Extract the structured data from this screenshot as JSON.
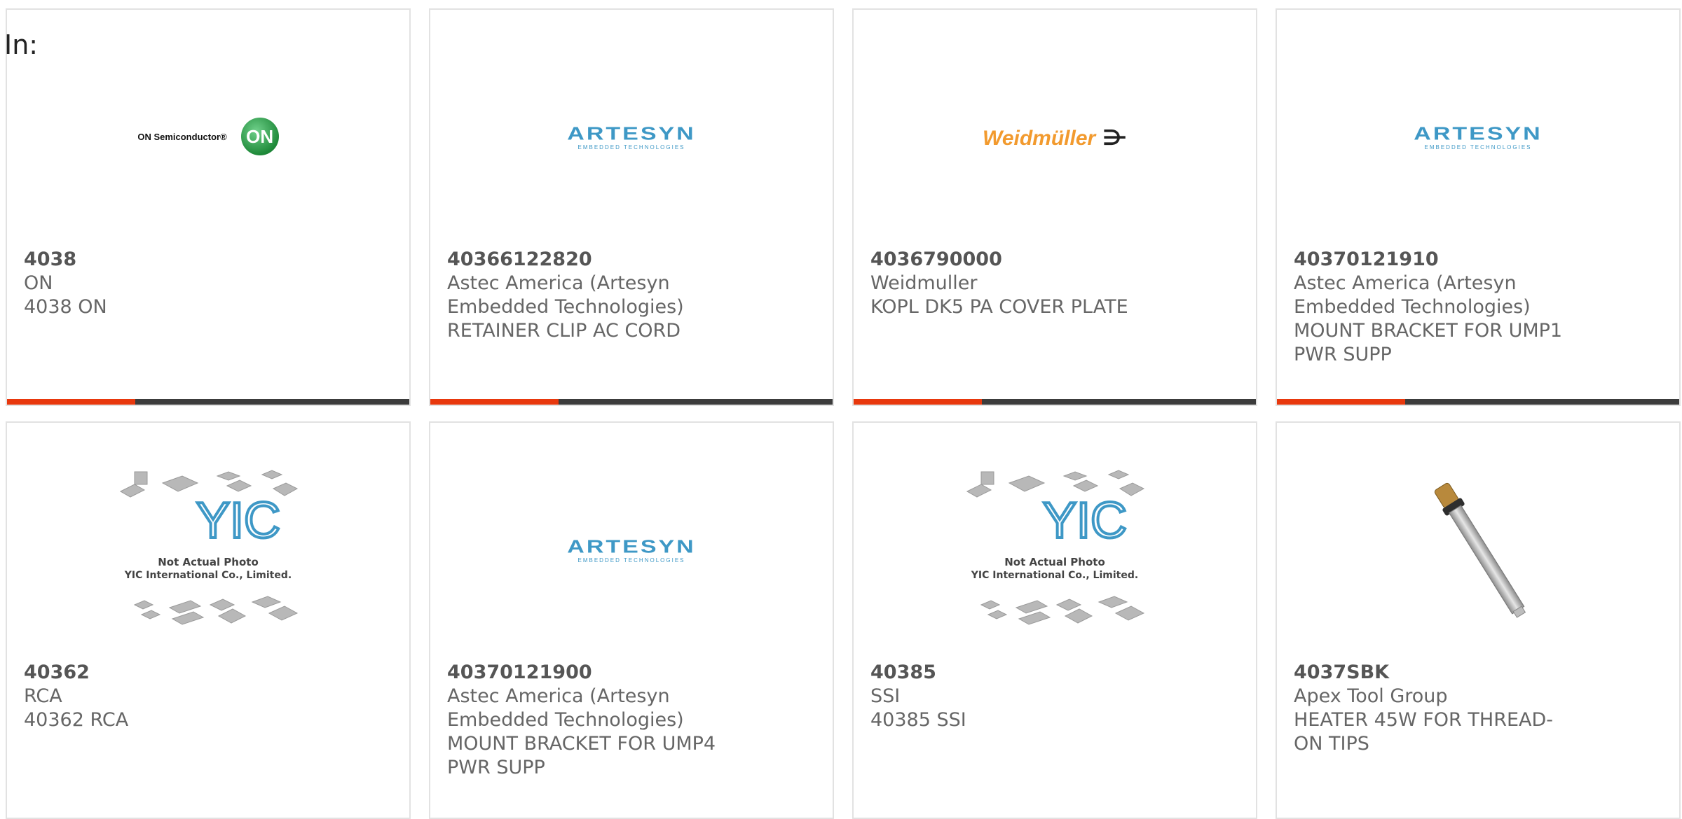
{
  "filter_label": "In:",
  "colors": {
    "accent": "#e8380d",
    "bar": "#3c3c3c",
    "text": "#666666"
  },
  "cards": [
    {
      "part_number": "4038",
      "manufacturer": "ON",
      "description": "4038 ON",
      "logo": "on-semiconductor-logo",
      "logo_text": "ON Semiconductor®",
      "logo_mark": "ON"
    },
    {
      "part_number": "40366122820",
      "manufacturer": "Astec America (Artesyn Embedded Technologies)",
      "description": "RETAINER CLIP AC CORD",
      "logo": "artesyn-logo",
      "logo_text": "ARTESYN",
      "logo_sub": "EMBEDDED TECHNOLOGIES"
    },
    {
      "part_number": "4036790000",
      "manufacturer": "Weidmuller",
      "description": "KOPL DK5 PA COVER PLATE",
      "logo": "weidmuller-logo",
      "logo_text": "Weidmüller"
    },
    {
      "part_number": "40370121910",
      "manufacturer": "Astec America (Artesyn Embedded Technologies)",
      "description": "MOUNT BRACKET FOR UMP1 PWR SUPP",
      "logo": "artesyn-logo",
      "logo_text": "ARTESYN",
      "logo_sub": "EMBEDDED TECHNOLOGIES"
    },
    {
      "part_number": "40362",
      "manufacturer": "RCA",
      "description": "40362 RCA",
      "logo": "yic-placeholder-image",
      "logo_text": "Not Actual Photo",
      "logo_sub": "YIC International Co., Limited."
    },
    {
      "part_number": "40370121900",
      "manufacturer": "Astec America (Artesyn Embedded Technologies)",
      "description": "MOUNT BRACKET FOR UMP4 PWR SUPP",
      "logo": "artesyn-logo",
      "logo_text": "ARTESYN",
      "logo_sub": "EMBEDDED TECHNOLOGIES"
    },
    {
      "part_number": "40385",
      "manufacturer": "SSI",
      "description": "40385 SSI",
      "logo": "yic-placeholder-image",
      "logo_text": "Not Actual Photo",
      "logo_sub": "YIC International Co., Limited."
    },
    {
      "part_number": "4037SBK",
      "manufacturer": "Apex Tool Group",
      "description": "HEATER 45W FOR THREAD-ON TIPS",
      "logo": "heater-product-photo"
    }
  ]
}
